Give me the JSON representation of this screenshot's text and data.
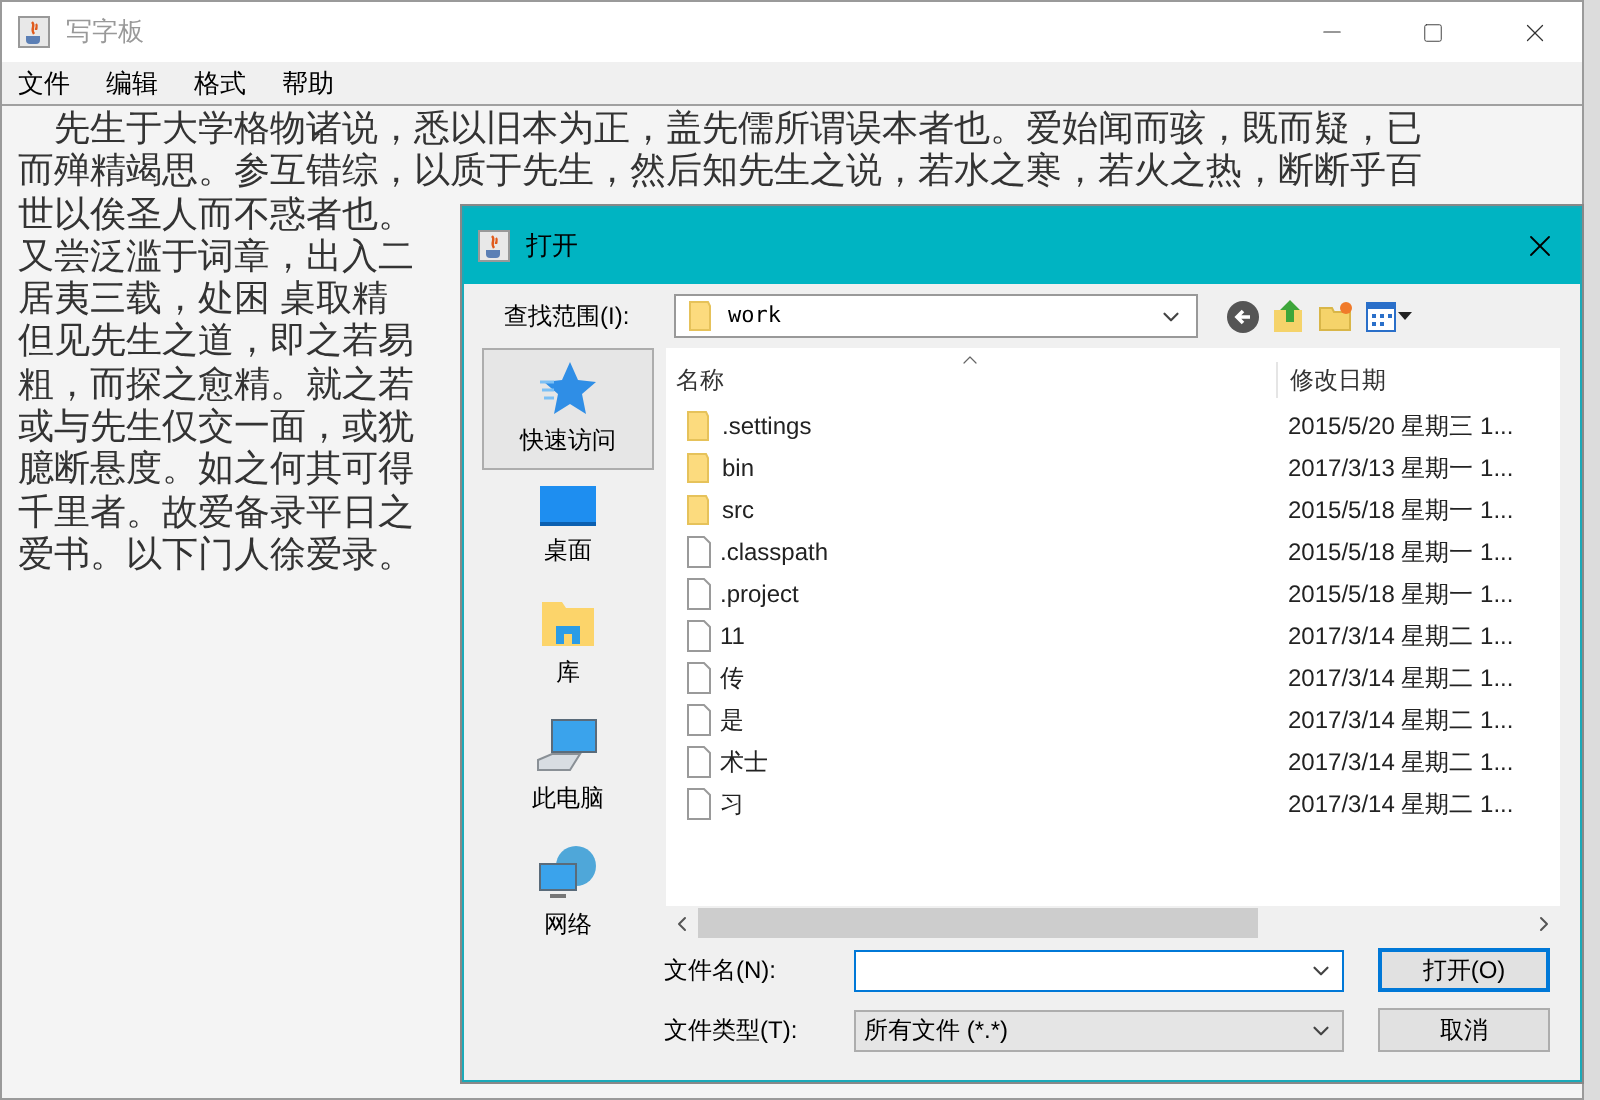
{
  "window": {
    "title": "写字板"
  },
  "menu": [
    "文件",
    "编辑",
    "格式",
    "帮助"
  ],
  "document": {
    "lines": [
      "　先生于大学格物诸说，悉以旧本为正，盖先儒所谓误本者也。爱始闻而骇，既而疑，已",
      "而殚精竭思。参互错综，以质于先生，然后知先生之说，若水之寒，若火之热，断断乎百",
      "世以俟圣人而不惑者也。",
      "又尝泛滥于词章，出入二",
      "居夷三载，处困 桌取精",
      "但见先生之道，即之若易",
      "粗，而探之愈精。就之若",
      "或与先生仅交一面，或犹",
      "臆断悬度。如之何其可得",
      "千里者。故爱备录平日之",
      "爱书。以下门人徐爱录。"
    ]
  },
  "dialog": {
    "title": "打开",
    "look_in": {
      "label": "查找范围(I):",
      "value": "work"
    },
    "places": [
      {
        "kind": "quick",
        "label": "快速访问",
        "selected": true
      },
      {
        "kind": "desktop",
        "label": "桌面",
        "selected": false
      },
      {
        "kind": "library",
        "label": "库",
        "selected": false
      },
      {
        "kind": "computer",
        "label": "此电脑",
        "selected": false
      },
      {
        "kind": "network",
        "label": "网络",
        "selected": false
      }
    ],
    "columns": [
      "名称",
      "修改日期"
    ],
    "files": [
      {
        "kind": "folder",
        "name": ".settings",
        "modified": "2015/5/20 星期三 1..."
      },
      {
        "kind": "folder",
        "name": "bin",
        "modified": "2017/3/13 星期一 1..."
      },
      {
        "kind": "folder",
        "name": "src",
        "modified": "2015/5/18 星期一 1..."
      },
      {
        "kind": "file",
        "name": ".classpath",
        "modified": "2015/5/18 星期一 1..."
      },
      {
        "kind": "file",
        "name": ".project",
        "modified": "2015/5/18 星期一 1..."
      },
      {
        "kind": "file",
        "name": "11",
        "modified": "2017/3/14 星期二 1..."
      },
      {
        "kind": "file",
        "name": "传",
        "modified": "2017/3/14 星期二 1..."
      },
      {
        "kind": "file",
        "name": "是",
        "modified": "2017/3/14 星期二 1..."
      },
      {
        "kind": "file",
        "name": "术士",
        "modified": "2017/3/14 星期二 1..."
      },
      {
        "kind": "file",
        "name": "习",
        "modified": "2017/3/14 星期二 1..."
      }
    ],
    "file_name": {
      "label": "文件名(N):"
    },
    "file_type": {
      "label": "文件类型(T):",
      "value": "所有文件 (*.*)"
    },
    "buttons": [
      "打开(O)",
      "取消"
    ]
  }
}
